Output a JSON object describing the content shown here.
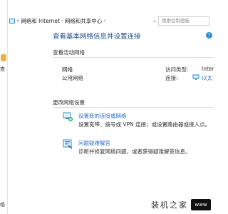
{
  "breadcrumb": {
    "overflow": "«",
    "items": [
      "网络和 Internet",
      "网络和共享中心"
    ],
    "separator": "›"
  },
  "search": {
    "placeholder": "搜索控制面板"
  },
  "left_panel": {
    "label": "查",
    "bottom_label": "络"
  },
  "header": {
    "title": "查看基本网络信息并设置连接"
  },
  "active_networks": {
    "section_title": "查看活动网络",
    "network_name": "网络",
    "network_type": "公用网络",
    "access_type_label": "访问类型:",
    "access_type_value": "Inter",
    "connections_label": "连接:",
    "connections_value": "以太"
  },
  "change_settings": {
    "section_title": "更改网络设置",
    "tasks": [
      {
        "icon": "network-setup-icon",
        "link": "设置新的连接或网络",
        "desc": "设置宽带、拨号或 VPN 连接；或设置路由器或接入点。"
      },
      {
        "icon": "troubleshoot-icon",
        "link": "问题疑难解答",
        "desc": "诊断并修复网络问题，或者获得疑难解答信息。"
      }
    ]
  },
  "watermark": {
    "text": "装机之家",
    "badge": "www"
  },
  "colors": {
    "accent": "#1f4e95",
    "link": "#2a6fc4",
    "icon_blue": "#2a8fd6"
  }
}
